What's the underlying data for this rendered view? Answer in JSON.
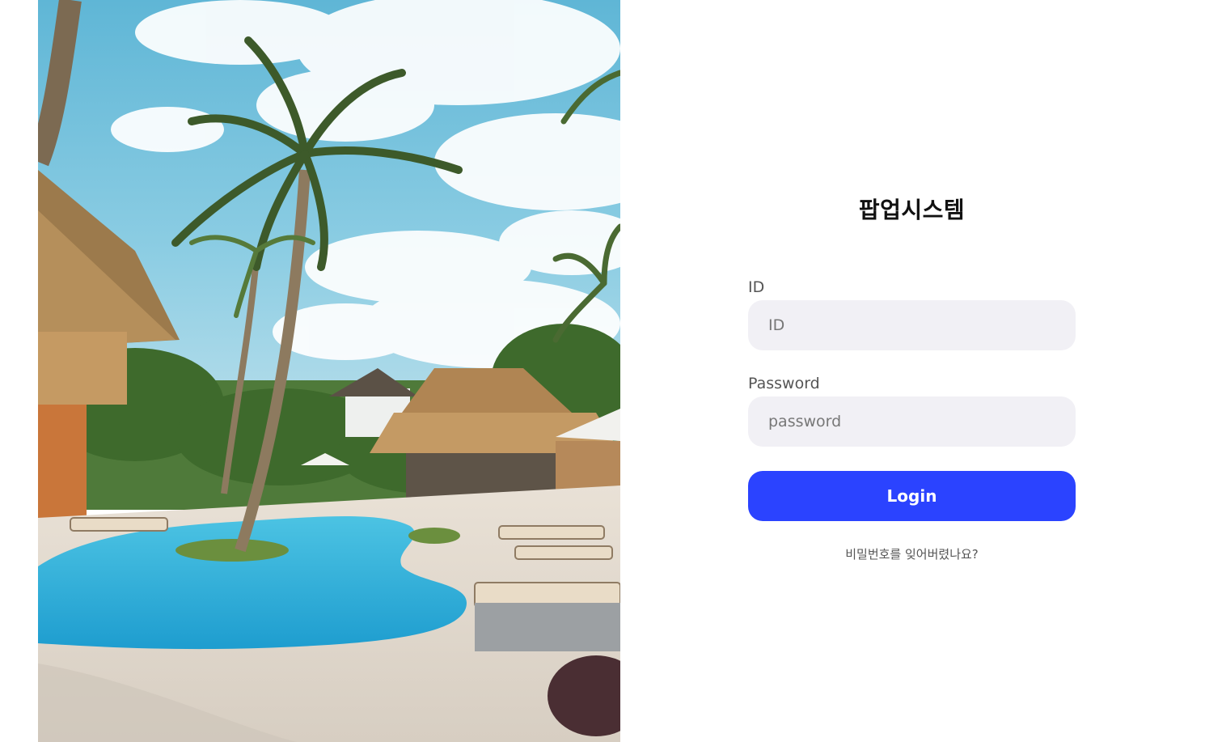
{
  "app": {
    "title": "팝업시스템"
  },
  "login_form": {
    "id_label": "ID",
    "id_placeholder": "ID",
    "password_label": "Password",
    "password_placeholder": "password",
    "login_label": "Login",
    "forgot_password_link": "비밀번호를 잊어버렸나요?"
  },
  "hero_image": {
    "icon": "resort-pool-photo"
  },
  "colors": {
    "accent": "#2b43ff",
    "input_bg": "#f1f0f5",
    "background": "#ffffff",
    "title": "#111111",
    "label": "#555555"
  }
}
